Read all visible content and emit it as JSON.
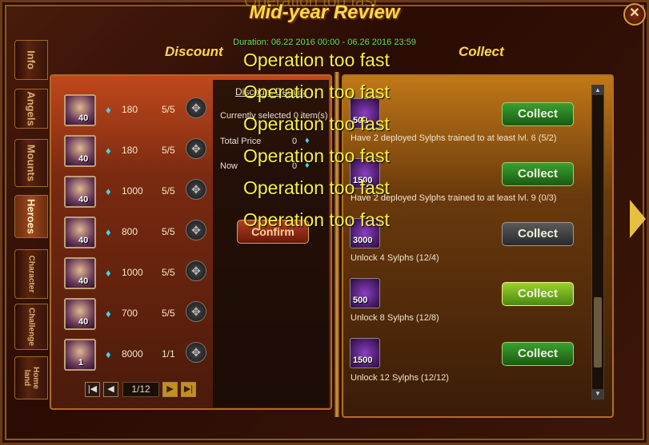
{
  "window": {
    "title": "Mid-year Review",
    "close": "✕"
  },
  "duration": "Duration: 06.22 2016 00:00 - 06.26 2016 23:59",
  "tabs": [
    {
      "label": "Info"
    },
    {
      "label": "Angels"
    },
    {
      "label": "Mounts"
    },
    {
      "label": "Heroes",
      "active": true
    },
    {
      "label": "Character"
    },
    {
      "label": "Challenge"
    },
    {
      "label": "Home land"
    }
  ],
  "discount": {
    "heading": "Discount",
    "items": [
      {
        "level": "40",
        "price": "180",
        "stock": "5/5"
      },
      {
        "level": "40",
        "price": "180",
        "stock": "5/5"
      },
      {
        "level": "40",
        "price": "1000",
        "stock": "5/5"
      },
      {
        "level": "40",
        "price": "800",
        "stock": "5/5"
      },
      {
        "level": "40",
        "price": "1000",
        "stock": "5/5"
      },
      {
        "level": "40",
        "price": "700",
        "stock": "5/5"
      },
      {
        "level": "1",
        "price": "8000",
        "stock": "1/1"
      }
    ],
    "page": "1/12",
    "details": {
      "title": "Discount Details",
      "selected": "Currently selected 0 item(s)",
      "total_label": "Total Price",
      "total_value": "0",
      "now_label": "Now",
      "now_value": "0",
      "confirm": "Confirm"
    }
  },
  "collect": {
    "heading": "Collect",
    "tasks": [
      {
        "qty": "500",
        "desc": "Have 2 deployed Sylphs trained to at least lvl. 6 (5/2)",
        "button": "Collect",
        "state": "green"
      },
      {
        "qty": "1500",
        "desc": "Have 2 deployed Sylphs trained to at least lvl. 9 (0/3)",
        "button": "Collect",
        "state": "green"
      },
      {
        "qty": "3000",
        "desc": "Unlock 4 Sylphs (12/4)",
        "button": "Collect",
        "state": "grey"
      },
      {
        "qty": "500",
        "desc": "Unlock 8 Sylphs (12/8)",
        "button": "Collect",
        "state": "highlight"
      },
      {
        "qty": "1500",
        "desc": "Unlock 12 Sylphs (12/12)",
        "button": "Collect",
        "state": "green"
      }
    ]
  },
  "toasts": [
    "Operation too fast",
    "Operation too fast",
    "Operation too fast",
    "Operation too fast",
    "Operation too fast",
    "Operation too fast"
  ],
  "toast_top": "Operation too fast",
  "icons": {
    "gem": "diamond-icon",
    "select": "selector-icon",
    "next": "right-arrow-icon"
  }
}
